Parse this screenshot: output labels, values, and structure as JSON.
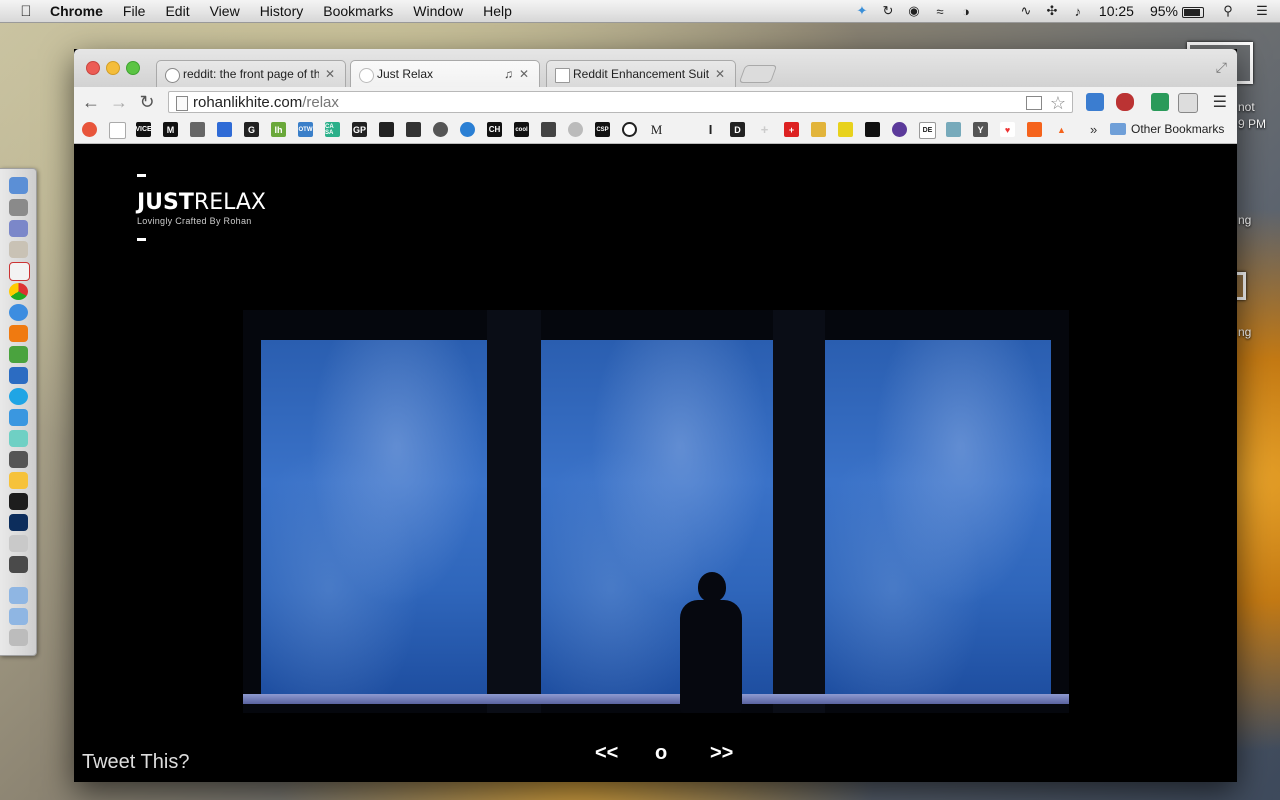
{
  "menubar": {
    "app_name": "Chrome",
    "menus": [
      "File",
      "Edit",
      "View",
      "History",
      "Bookmarks",
      "Window",
      "Help"
    ],
    "clock": "10:25",
    "battery": "95%"
  },
  "desktop": {
    "fragments": [
      "not",
      "9 PM",
      "ng",
      "ng"
    ]
  },
  "browser": {
    "tabs": [
      {
        "title": "reddit: the front page of th",
        "active": false
      },
      {
        "title": "Just Relax",
        "active": true
      },
      {
        "title": "Reddit Enhancement Suite",
        "active": false
      }
    ],
    "url_host": "rohanlikhite.com",
    "url_path": "/relax",
    "bookmarks_labels": [
      "VICE",
      "M",
      "G",
      "lh",
      "OTW",
      "CA SA",
      "GP",
      "CH",
      "cool",
      "CSP",
      "M",
      "I",
      "D",
      "DE"
    ],
    "more": "»",
    "other_bookmarks": "Other Bookmarks"
  },
  "page": {
    "logo_bold": "JUST",
    "logo_light": "RELAX",
    "tagline": "Lovingly Crafted By Rohan",
    "prev": "<<",
    "play": "o",
    "next": ">>",
    "tweet": "Tweet This?"
  }
}
